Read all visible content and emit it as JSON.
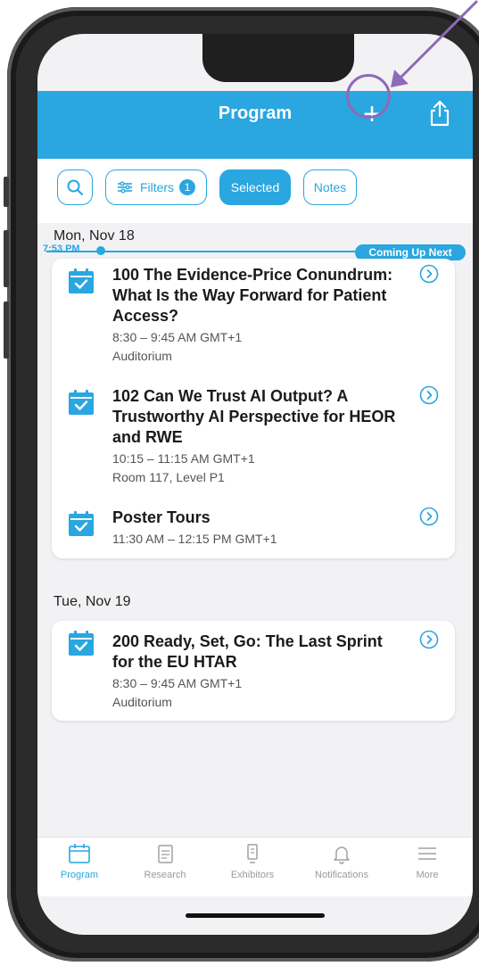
{
  "header": {
    "title": "Program"
  },
  "filters": {
    "filters_label": "Filters",
    "filters_count": "1",
    "selected_label": "Selected",
    "notes_label": "Notes"
  },
  "now": {
    "time": "7:53 PM",
    "coming_up": "Coming Up Next"
  },
  "days": [
    {
      "label": "Mon, Nov 18",
      "sessions": [
        {
          "title": "100 The Evidence-Price Conundrum: What Is the Way Forward for Patient Access?",
          "time": "8:30 – 9:45 AM GMT+1",
          "location": "Auditorium"
        },
        {
          "title": "102 Can We Trust AI Output? A Trustworthy AI Perspective for HEOR and RWE",
          "time": "10:15 – 11:15 AM GMT+1",
          "location": "Room 117, Level P1"
        },
        {
          "title": "Poster Tours",
          "time": "11:30 AM – 12:15 PM GMT+1",
          "location": ""
        }
      ]
    },
    {
      "label": "Tue, Nov 19",
      "sessions": [
        {
          "title": "200 Ready, Set, Go: The Last Sprint for the EU HTAR",
          "time": "8:30 – 9:45 AM GMT+1",
          "location": "Auditorium"
        }
      ]
    }
  ],
  "tabs": [
    {
      "label": "Program"
    },
    {
      "label": "Research"
    },
    {
      "label": "Exhibitors"
    },
    {
      "label": "Notifications"
    },
    {
      "label": "More"
    }
  ],
  "colors": {
    "accent": "#2aa6e0",
    "highlight": "#8e6ab8"
  },
  "icons": [
    "search-icon",
    "filter-icon",
    "plus-icon",
    "share-icon",
    "calendar-check-icon",
    "chevron-right-icon",
    "program-icon",
    "research-icon",
    "exhibitors-icon",
    "bell-icon",
    "menu-icon"
  ]
}
